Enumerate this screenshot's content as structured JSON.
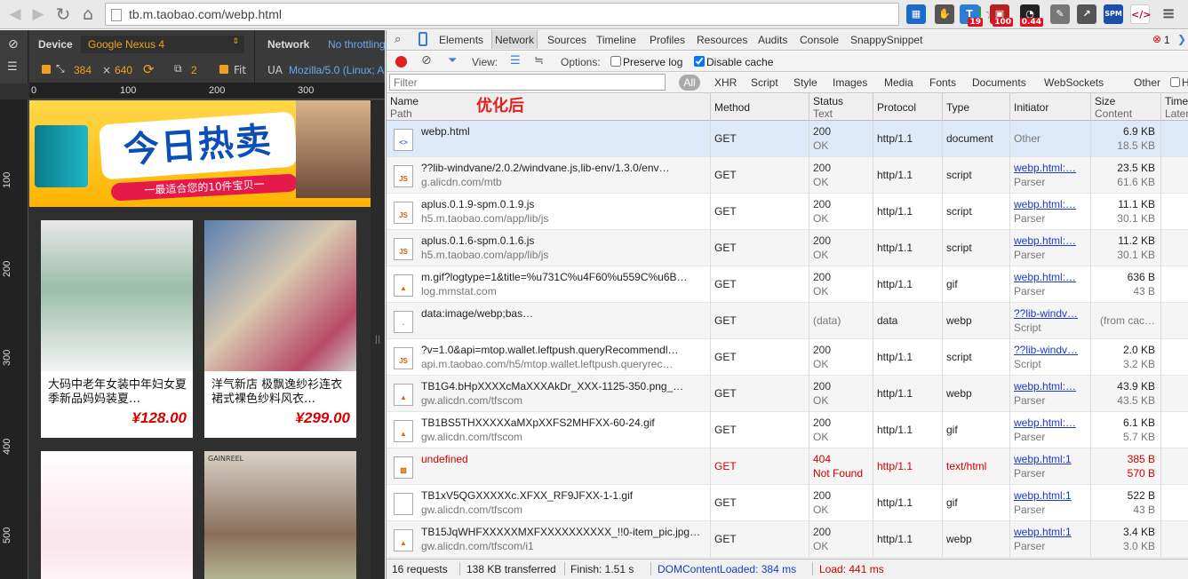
{
  "browser": {
    "url": "tb.m.taobao.com/webp.html",
    "ext_badges": [
      "19",
      "100",
      "0.44"
    ]
  },
  "device_mode": {
    "device_label": "Device",
    "device_value": "Google Nexus 4",
    "network_label": "Network",
    "network_value": "No throttling",
    "width": "384",
    "times": "×",
    "height": "640",
    "dpr": "2",
    "fit_label": "Fit",
    "ua_label": "UA",
    "ua_value": "Mozilla/5.0 (Linux; Android 4.4.4; en-us; Nexus 4 Build/JOP40D)",
    "ruler_h": [
      "0",
      "100",
      "200",
      "300"
    ],
    "ruler_v": [
      "100",
      "200",
      "300",
      "400",
      "500"
    ]
  },
  "page": {
    "banner_title": "今日热卖",
    "banner_subtitle": "一最适合您的10件宝贝一",
    "products": [
      {
        "name": "大码中老年女装中年妇女夏季新品妈妈装夏…",
        "price": "¥128.00"
      },
      {
        "name": "洋气新店 极飘逸纱衫连衣裙式裸色纱料风衣…",
        "price": "¥299.00"
      },
      {
        "name": "",
        "price": ""
      },
      {
        "name": "",
        "price": ""
      }
    ],
    "brand_logo": "GAINREEL"
  },
  "devtools": {
    "tabs": [
      "Elements",
      "Network",
      "Sources",
      "Timeline",
      "Profiles",
      "Resources",
      "Audits",
      "Console",
      "SnappySnippet"
    ],
    "active_tab": "Network",
    "error_count": "1",
    "toolbar": {
      "view_label": "View:",
      "options_label": "Options:",
      "preserve_log": "Preserve log",
      "preserve_log_checked": false,
      "disable_cache": "Disable cache",
      "disable_cache_checked": true
    },
    "filter_placeholder": "Filter",
    "filter_types": [
      "All",
      "XHR",
      "Script",
      "Style",
      "Images",
      "Media",
      "Fonts",
      "Documents",
      "WebSockets",
      "Other"
    ],
    "hide_label": "H",
    "annotation": "优化后",
    "columns": {
      "name": "Name",
      "path": "Path",
      "method": "Method",
      "status": "Status",
      "text": "Text",
      "protocol": "Protocol",
      "type": "Type",
      "initiator": "Initiator",
      "size": "Size",
      "content": "Content",
      "time": "Time",
      "latency": "Laten"
    },
    "requests": [
      {
        "icon": "html",
        "name": "webp.html",
        "path": "",
        "method": "GET",
        "status": "200",
        "text": "OK",
        "protocol": "http/1.1",
        "type": "document",
        "initiator": "Other",
        "initiator2": "",
        "size": "6.9 KB",
        "content": "18.5 KB",
        "error": false
      },
      {
        "icon": "js",
        "name": "??lib-windvane/2.0.2/windvane.js,lib-env/1.3.0/env…",
        "path": "g.alicdn.com/mtb",
        "method": "GET",
        "status": "200",
        "text": "OK",
        "protocol": "http/1.1",
        "type": "script",
        "initiator": "webp.html:…",
        "initiator2": "Parser",
        "size": "23.5 KB",
        "content": "61.6 KB",
        "error": false
      },
      {
        "icon": "js",
        "name": "aplus.0.1.9-spm.0.1.9.js",
        "path": "h5.m.taobao.com/app/lib/js",
        "method": "GET",
        "status": "200",
        "text": "OK",
        "protocol": "http/1.1",
        "type": "script",
        "initiator": "webp.html:…",
        "initiator2": "Parser",
        "size": "11.1 KB",
        "content": "30.1 KB",
        "error": false
      },
      {
        "icon": "js",
        "name": "aplus.0.1.6-spm.0.1.6.js",
        "path": "h5.m.taobao.com/app/lib/js",
        "method": "GET",
        "status": "200",
        "text": "OK",
        "protocol": "http/1.1",
        "type": "script",
        "initiator": "webp.html:…",
        "initiator2": "Parser",
        "size": "11.2 KB",
        "content": "30.1 KB",
        "error": false
      },
      {
        "icon": "img",
        "name": "m.gif?logtype=1&title=%u731C%u4F60%u559C%u6B…",
        "path": "log.mmstat.com",
        "method": "GET",
        "status": "200",
        "text": "OK",
        "protocol": "http/1.1",
        "type": "gif",
        "initiator": "webp.html:…",
        "initiator2": "Parser",
        "size": "636 B",
        "content": "43 B",
        "error": false
      },
      {
        "icon": "dot",
        "name": "data:image/webp;bas…",
        "path": "",
        "method": "GET",
        "status": "(data)",
        "text": "",
        "protocol": "data",
        "type": "webp",
        "initiator": "??lib-windv…",
        "initiator2": "Script",
        "size": "(from cac…",
        "content": "",
        "error": false
      },
      {
        "icon": "js",
        "name": "?v=1.0&api=mtop.wallet.leftpush.queryRecommendl…",
        "path": "api.m.taobao.com/h5/mtop.wallet.leftpush.queryrec…",
        "method": "GET",
        "status": "200",
        "text": "OK",
        "protocol": "http/1.1",
        "type": "script",
        "initiator": "??lib-windv…",
        "initiator2": "Script",
        "size": "2.0 KB",
        "content": "3.2 KB",
        "error": false
      },
      {
        "icon": "img",
        "name": "TB1G4.bHpXXXXcMaXXXAkDr_XXX-1125-350.png_…",
        "path": "gw.alicdn.com/tfscom",
        "method": "GET",
        "status": "200",
        "text": "OK",
        "protocol": "http/1.1",
        "type": "webp",
        "initiator": "webp.html:…",
        "initiator2": "Parser",
        "size": "43.9 KB",
        "content": "43.5 KB",
        "error": false
      },
      {
        "icon": "img",
        "name": "TB1BS5THXXXXXaMXpXXFS2MHFXX-60-24.gif",
        "path": "gw.alicdn.com/tfscom",
        "method": "GET",
        "status": "200",
        "text": "OK",
        "protocol": "http/1.1",
        "type": "gif",
        "initiator": "webp.html:…",
        "initiator2": "Parser",
        "size": "6.1 KB",
        "content": "5.7 KB",
        "error": false
      },
      {
        "icon": "broken",
        "name": "undefined",
        "path": "",
        "method": "GET",
        "status": "404",
        "text": "Not Found",
        "protocol": "http/1.1",
        "type": "text/html",
        "initiator": "webp.html:1",
        "initiator2": "Parser",
        "size": "385 B",
        "content": "570 B",
        "error": true
      },
      {
        "icon": "blank",
        "name": "TB1xV5QGXXXXXc.XFXX_RF9JFXX-1-1.gif",
        "path": "gw.alicdn.com/tfscom",
        "method": "GET",
        "status": "200",
        "text": "OK",
        "protocol": "http/1.1",
        "type": "gif",
        "initiator": "webp.html:1",
        "initiator2": "Parser",
        "size": "522 B",
        "content": "43 B",
        "error": false
      },
      {
        "icon": "img",
        "name": "TB15JqWHFXXXXXMXFXXXXXXXXXX_!!0-item_pic.jpg…",
        "path": "gw.alicdn.com/tfscom/i1",
        "method": "GET",
        "status": "200",
        "text": "OK",
        "protocol": "http/1.1",
        "type": "webp",
        "initiator": "webp.html:1",
        "initiator2": "Parser",
        "size": "3.4 KB",
        "content": "3.0 KB",
        "error": false
      }
    ],
    "status_bar": {
      "requests": "16 requests",
      "transferred": "138 KB transferred",
      "finish": "Finish: 1.51 s",
      "dcl": "DOMContentLoaded: 384 ms",
      "load": "Load: 441 ms"
    },
    "colors": {
      "dcl": "#1a3ac7",
      "load": "#d00000",
      "error": "#d00000",
      "selected_row": "#dceaf9"
    }
  }
}
